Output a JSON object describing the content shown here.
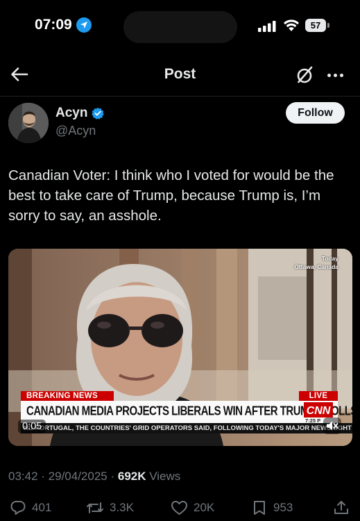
{
  "status_bar": {
    "time": "07:09",
    "battery": "57"
  },
  "header": {
    "title": "Post"
  },
  "author": {
    "name": "Acyn",
    "handle": "@Acyn",
    "follow_label": "Follow"
  },
  "tweet": {
    "text": "Canadian Voter: I think who I voted for would be the best to take care of Trump, because Trump is, I’m sorry to say, an asshole."
  },
  "video": {
    "location_line1": "Today",
    "location_line2": "Ottawa, Canada",
    "breaking_label": "BREAKING NEWS",
    "live_label": "LIVE",
    "headline": "CANADIAN MEDIA PROJECTS LIBERALS WIN AFTER TRUMP TROLLS",
    "network": "CNN",
    "clock": "7:25 P",
    "ticker": "ND PORTUGAL, THE COUNTRIES' GRID OPERATORS SAID, FOLLOWING TODAY'S MAJOR NEWSNIGHT",
    "duration": "0:05"
  },
  "meta": {
    "time": "03:42",
    "separator": " · ",
    "date": "29/04/2025",
    "views_count": "692K",
    "views_label": "Views"
  },
  "actions": {
    "replies": "401",
    "reposts": "3.3K",
    "likes": "20K",
    "bookmarks": "953"
  },
  "icons": [
    "location-arrow-icon",
    "signal-icon",
    "wifi-icon",
    "battery-icon",
    "back-arrow-icon",
    "grok-icon",
    "more-icon",
    "verified-icon",
    "mute-icon",
    "reply-icon",
    "repost-icon",
    "like-icon",
    "bookmark-icon",
    "share-icon"
  ],
  "colors": {
    "accent": "#1d9bf0",
    "background": "#000000",
    "secondary_text": "#71767b",
    "breaking_red": "#cc0000"
  }
}
